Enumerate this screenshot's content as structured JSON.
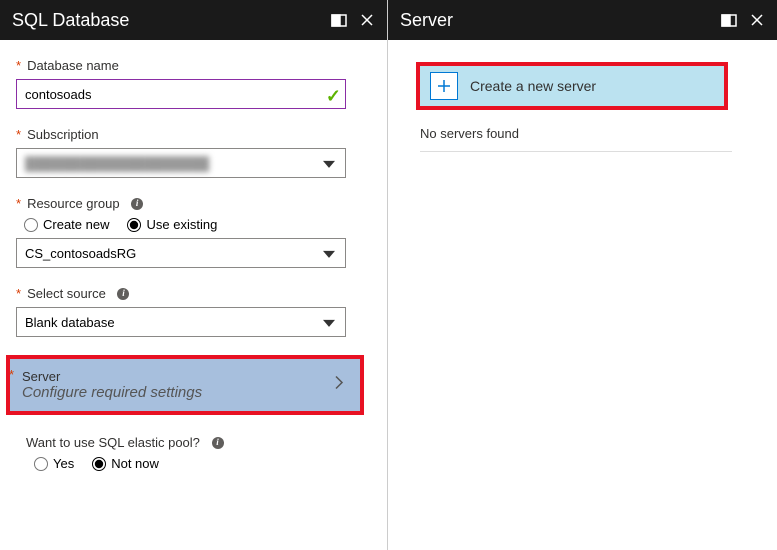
{
  "left": {
    "title": "SQL Database",
    "database_name": {
      "label": "Database name",
      "value": "contosoads"
    },
    "subscription": {
      "label": "Subscription",
      "value": "████████████████████"
    },
    "resource_group": {
      "label": "Resource group",
      "options": {
        "create": "Create new",
        "existing": "Use existing"
      },
      "value": "CS_contosoadsRG"
    },
    "select_source": {
      "label": "Select source",
      "value": "Blank database"
    },
    "server": {
      "label": "Server",
      "sub": "Configure required settings"
    },
    "elastic_pool": {
      "question": "Want to use SQL elastic pool?",
      "options": {
        "yes": "Yes",
        "no": "Not now"
      }
    }
  },
  "right": {
    "title": "Server",
    "create": "Create a new server",
    "empty": "No servers found"
  }
}
